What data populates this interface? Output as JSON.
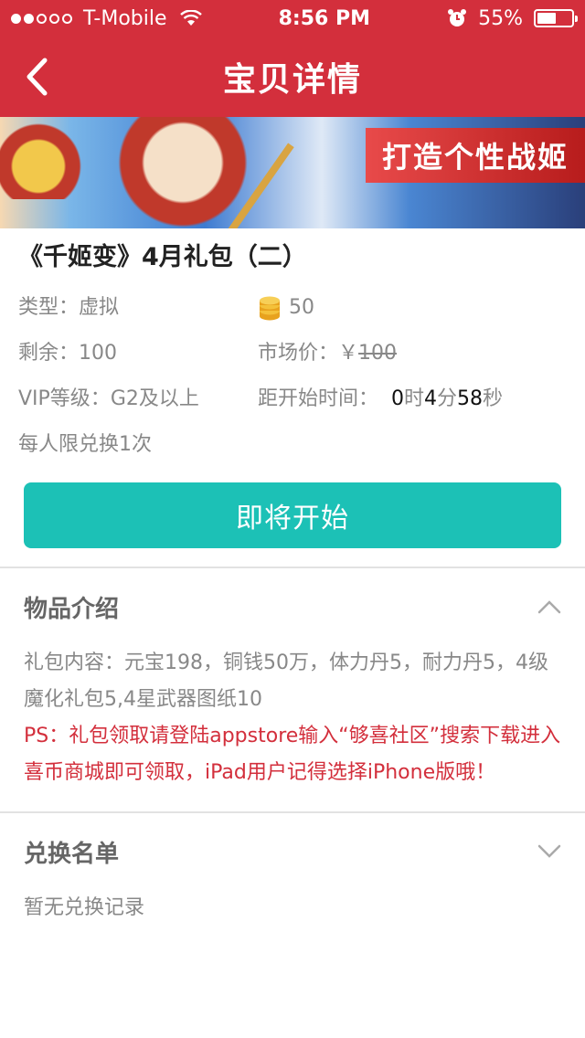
{
  "status_bar": {
    "carrier": "T-Mobile",
    "time": "8:56 PM",
    "battery": "55%",
    "battery_level": 0.55
  },
  "nav": {
    "title": "宝贝详情"
  },
  "banner": {
    "slogan": "打造个性战姬"
  },
  "product": {
    "title": "《千姬变》4月礼包（二）",
    "type_label": "类型：",
    "type_value": "虚拟",
    "coin_value": "50",
    "remaining_label": "剩余：",
    "remaining_value": "100",
    "market_label": "市场价：",
    "market_currency": "￥",
    "market_value": "100",
    "vip_label": "VIP等级：",
    "vip_value": "G2及以上",
    "countdown_label": "距开始时间：",
    "countdown": {
      "hours": "0",
      "hours_unit": "时",
      "minutes": "4",
      "minutes_unit": "分",
      "seconds": "58",
      "seconds_unit": "秒"
    },
    "limit_text": "每人限兑换1次"
  },
  "action": {
    "button_label": "即将开始"
  },
  "intro": {
    "title": "物品介绍",
    "content": "礼包内容：元宝198，铜钱50万，体力丹5，耐力丹5，4级魔化礼包5,4星武器图纸10",
    "note": "PS：礼包领取请登陆appstore输入“够喜社区”搜索下载进入喜币商城即可领取，iPad用户记得选择iPhone版哦！"
  },
  "redeem": {
    "title": "兑换名单",
    "empty_text": "暂无兑换记录"
  },
  "colors": {
    "brand": "#d32f3c",
    "accent": "#1cc1b6"
  },
  "icons": [
    "signal-dots-icon",
    "wifi-icon",
    "alarm-icon",
    "battery-icon",
    "back-arrow-icon",
    "coin-stack-icon",
    "chevron-up-icon",
    "chevron-down-icon"
  ]
}
